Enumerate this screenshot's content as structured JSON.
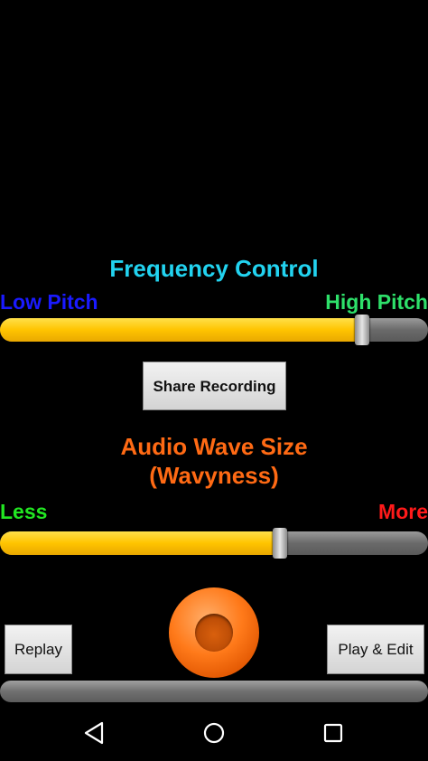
{
  "frequency": {
    "title": "Frequency Control",
    "low_label": "Low Pitch",
    "high_label": "High Pitch",
    "slider_value": 0.845
  },
  "share": {
    "label": "Share Recording"
  },
  "wave": {
    "title_line1": "Audio Wave Size",
    "title_line2": "(Wavyness)",
    "less_label": "Less",
    "more_label": "More",
    "slider_value": 0.653
  },
  "controls": {
    "replay_label": "Replay",
    "play_edit_label": "Play & Edit"
  },
  "colors": {
    "frequency_title": "#22d3f0",
    "low_pitch": "#1a1aff",
    "high_pitch": "#2ee06a",
    "wave_title": "#ff6a14",
    "less": "#22e622",
    "more": "#ff1a1a",
    "slider_fill": "#ffc400",
    "record_button": "#ff7a1a"
  },
  "navbar": {
    "icons": [
      "back-icon",
      "home-icon",
      "recent-apps-icon"
    ]
  }
}
